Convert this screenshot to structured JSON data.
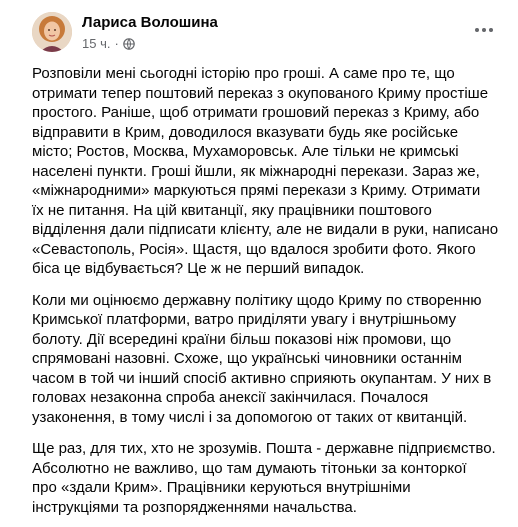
{
  "author": {
    "name": "Лариса Волошина",
    "timestamp": "15 ч.",
    "separator": "·",
    "privacy_icon": "globe-icon"
  },
  "menu_icon": "more-horizontal-icon",
  "post": {
    "paragraphs": [
      {
        "lines": [
          "Розповіли мені сьогодні історію про гроші. А саме про те, що",
          "отримати тепер поштовий переказ з окупованого Криму простіше",
          "простого. Раніше, щоб отримати грошовий переказ з Криму, або",
          "відправити в Крим, доводилося вказувати будь яке російське",
          "місто; Ростов, Москва, Мухаморовськ. Але тільки не кримські",
          "населені пункти. Гроші йшли, як міжнародні перекази. Зараз же,",
          "«міжнародними» маркуються прямі перекази з Криму. Отримати",
          "їх не питання. На цій квитанції, яку працівники поштового",
          "відділення дали підписати клієнту, але не видали в руки, написано",
          "«Севастополь, Росія». Щастя, що вдалося зробити фото.   Якого",
          "біса це відбувається? Це ж не перший випадок."
        ]
      },
      {
        "lines": [
          "Коли ми оцінюємо державну політику щодо Криму по створенню",
          "Кримської платформи, ватро приділяти увагу і внутрішньому",
          "болоту. Дії всередині країни більш показові ніж промови, що",
          "спрямовані назовні. Схоже, що українські чиновники останнім",
          "часом в той чи інший спосіб активно сприяють окупантам. У них в",
          "головах незаконна спроба анексії закінчилася. Почалося",
          "узаконення, в тому числі і за допомогою от таких от квитанцій."
        ]
      },
      {
        "lines": [
          "Ще раз, для тих, хто не зрозумів. Пошта - державне підприємство.",
          "Абсолютно не важливо, що там думають тітоньки за конторкої",
          "про «здали Крим». Працівники керуються внутрішніми",
          "інструкціями та розпорядженнями начальства."
        ]
      }
    ]
  }
}
